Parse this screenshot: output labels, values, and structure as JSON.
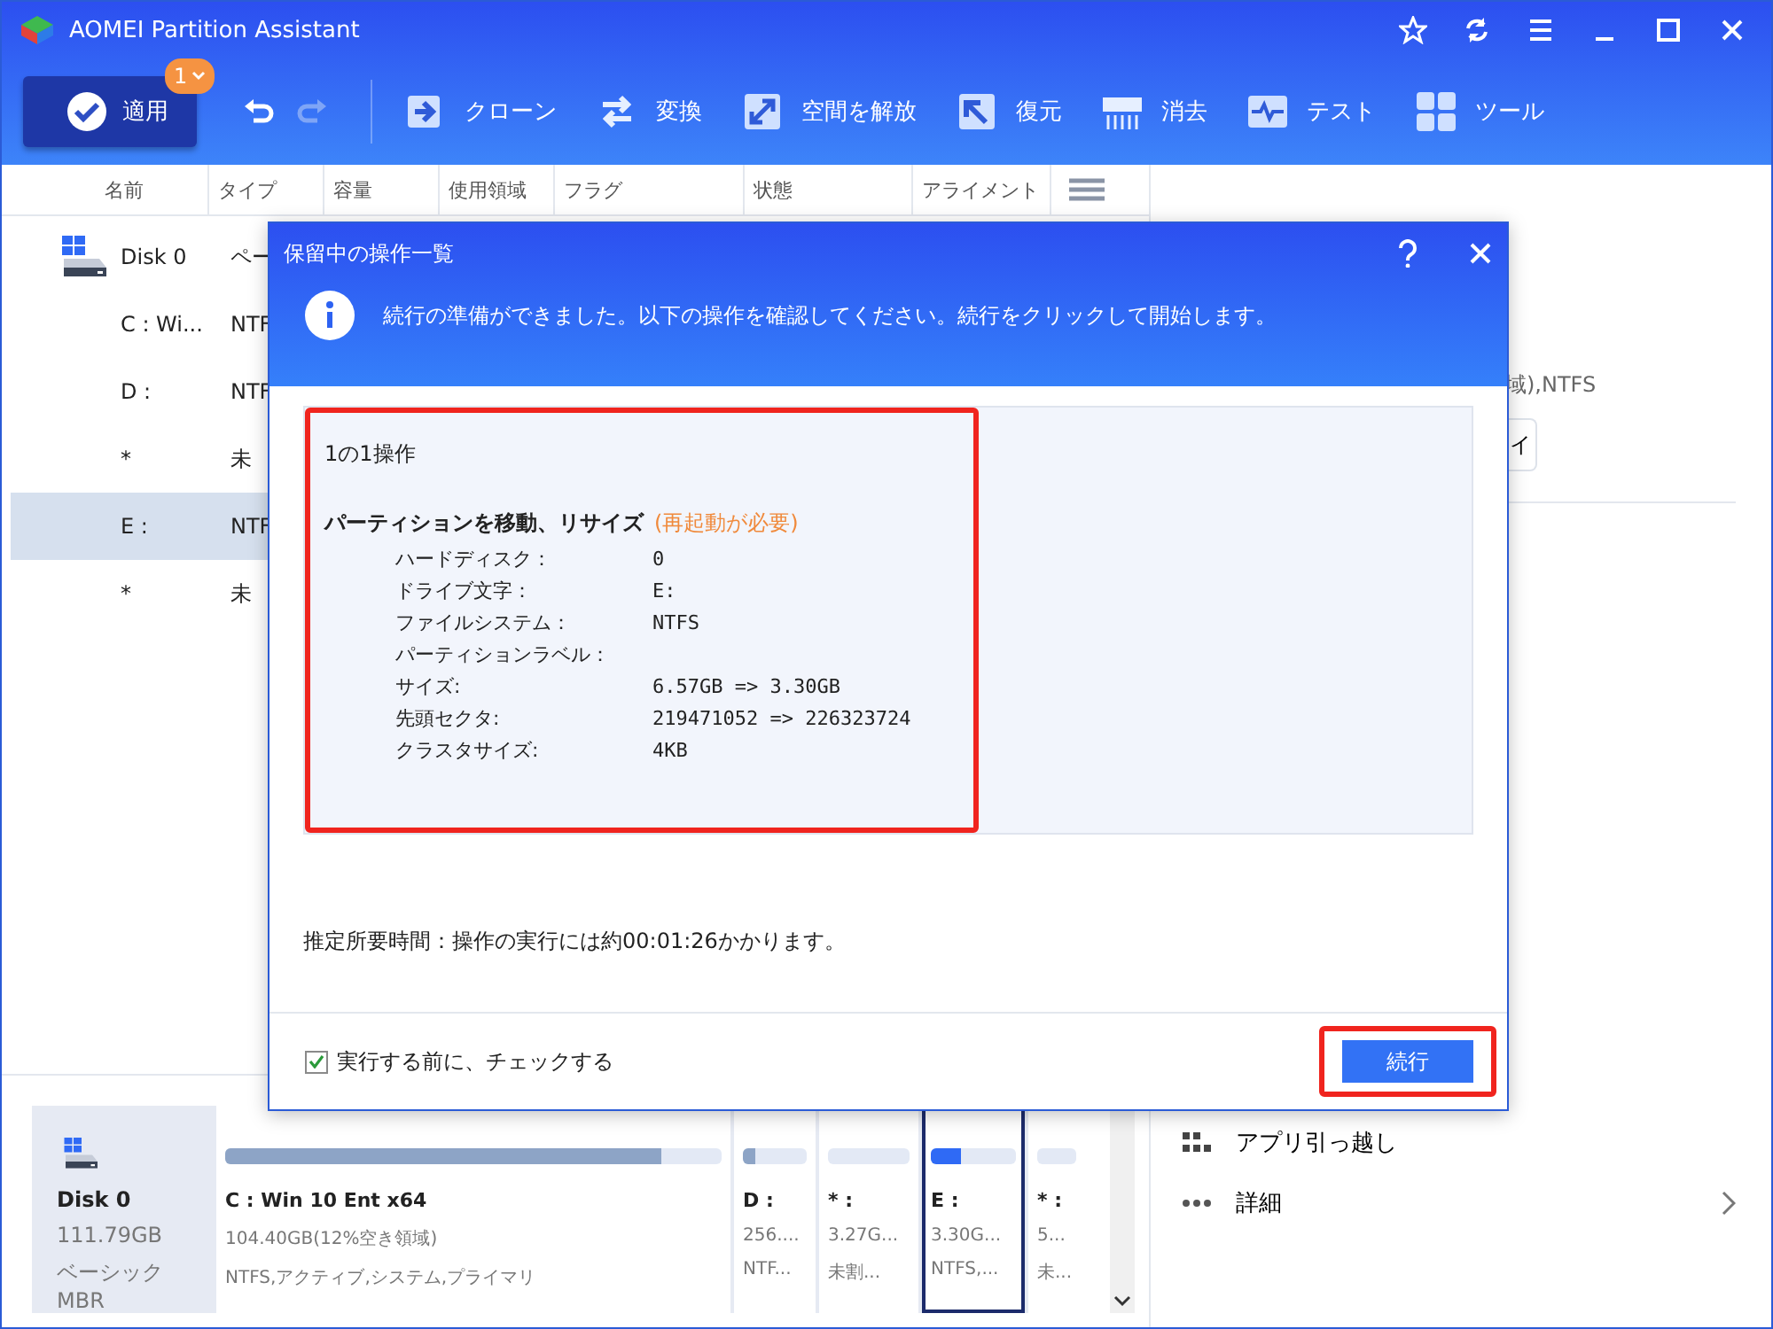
{
  "window": {
    "title": "AOMEI Partition Assistant"
  },
  "toolbar": {
    "apply": {
      "label": "適用",
      "badge": "1"
    },
    "tools": [
      {
        "kind": "clone",
        "label": "クローン"
      },
      {
        "kind": "convert",
        "label": "変換"
      },
      {
        "kind": "free",
        "label": "空間を解放"
      },
      {
        "kind": "restore",
        "label": "復元"
      },
      {
        "kind": "wipe",
        "label": "消去"
      },
      {
        "kind": "test",
        "label": "テスト"
      },
      {
        "kind": "tools",
        "label": "ツール"
      }
    ]
  },
  "table": {
    "columns": [
      "名前",
      "タイプ",
      "容量",
      "使用領域",
      "フラグ",
      "状態",
      "アライメント"
    ],
    "rows": [
      {
        "kind": "disk",
        "name": "Disk 0",
        "type": "ペー",
        "selected": false
      },
      {
        "kind": "partition",
        "name": "C : Wi...",
        "type": "NTF",
        "selected": false
      },
      {
        "kind": "partition",
        "name": "D :",
        "type": "NTF",
        "selected": false
      },
      {
        "kind": "partition",
        "name": "*",
        "type": "未",
        "selected": false
      },
      {
        "kind": "partition",
        "name": "E :",
        "type": "NTF",
        "selected": true
      },
      {
        "kind": "partition",
        "name": "*",
        "type": "未",
        "selected": false
      }
    ]
  },
  "right_panel": {
    "info": "域),NTFS",
    "button": "イ",
    "actions": [
      {
        "kind": "apps",
        "label": "アプリ引っ越し"
      },
      {
        "kind": "more",
        "label": "詳細"
      }
    ]
  },
  "disk_map": {
    "disk": {
      "name": "Disk 0",
      "size": "111.79GB",
      "type": "ベーシック MBR"
    },
    "partitions": [
      {
        "name": "C : Win 10 Ent x64",
        "size": "104.40GB(12%空き領域)",
        "info": "NTFS,アクティブ,システム,プライマリ",
        "level": 0.88,
        "selected": false
      },
      {
        "name": "D :",
        "size": "256....",
        "info": "NTF...",
        "level": 0.2,
        "selected": false
      },
      {
        "name": "* :",
        "size": "3.27G...",
        "info": "未割...",
        "level": 0,
        "selected": false
      },
      {
        "name": "E :",
        "size": "3.30G...",
        "info": "NTFS,...",
        "level": 0.35,
        "selected": true
      },
      {
        "name": "* :",
        "size": "5...",
        "info": "未...",
        "level": 0,
        "selected": false
      }
    ]
  },
  "dialog": {
    "title": "保留中の操作一覧",
    "message": "続行の準備ができました。以下の操作を確認してください。続行をクリックして開始します。",
    "operation": {
      "highlighted": true,
      "count": "1の1操作",
      "title": "パーティションを移動、リサイズ",
      "note": "(再起動が必要)",
      "details": [
        {
          "label": "ハードディスク：",
          "value": "0"
        },
        {
          "label": "ドライブ文字：",
          "value": "E:"
        },
        {
          "label": "ファイルシステム：",
          "value": "NTFS"
        },
        {
          "label": "パーティションラベル："
        },
        {
          "label": "サイズ:",
          "value": "6.57GB => 3.30GB"
        },
        {
          "label": "先頭セクタ:",
          "value": "219471052 => 226323724"
        },
        {
          "label": "クラスタサイズ:",
          "value": "4KB"
        }
      ]
    },
    "estimate": "推定所要時間：操作の実行には約00:01:26かかります。",
    "check": {
      "label": "実行する前に、チェックする",
      "checked": true
    },
    "continue": {
      "label": "続行",
      "highlighted": true
    }
  }
}
